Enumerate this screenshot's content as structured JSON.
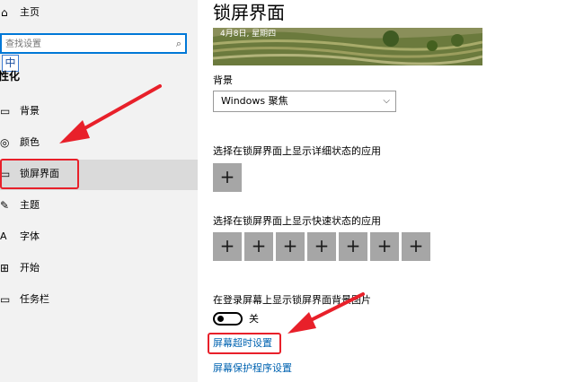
{
  "sidebar": {
    "home_label": "主页",
    "search": {
      "placeholder": "查找设置"
    },
    "ime_indicator": "中",
    "section_title": "个性化",
    "items": [
      {
        "label": "背景",
        "icon": "picture-icon"
      },
      {
        "label": "颜色",
        "icon": "palette-icon"
      },
      {
        "label": "锁屏界面",
        "icon": "lock-screen-icon",
        "selected": true
      },
      {
        "label": "主题",
        "icon": "brush-icon"
      },
      {
        "label": "字体",
        "icon": "font-icon"
      },
      {
        "label": "开始",
        "icon": "start-icon"
      },
      {
        "label": "任务栏",
        "icon": "taskbar-icon"
      }
    ]
  },
  "main": {
    "title": "锁屏界面",
    "preview": {
      "date_text": "4月8日, 星期四"
    },
    "background": {
      "label": "背景",
      "selected": "Windows 聚焦"
    },
    "detailed_status": {
      "label": "选择在锁屏界面上显示详细状态的应用",
      "slots": [
        "+"
      ]
    },
    "quick_status": {
      "label": "选择在锁屏界面上显示快速状态的应用",
      "slots": [
        "+",
        "+",
        "+",
        "+",
        "+",
        "+",
        "+"
      ]
    },
    "signin_bg": {
      "label": "在登录屏幕上显示锁屏界面背景图片",
      "state": "关",
      "on": false
    },
    "links": {
      "timeout": "屏幕超时设置",
      "screensaver": "屏幕保护程序设置"
    }
  },
  "colors": {
    "accent": "#0063b1",
    "annotation": "#e8202a",
    "slot": "#a6a6a6"
  }
}
